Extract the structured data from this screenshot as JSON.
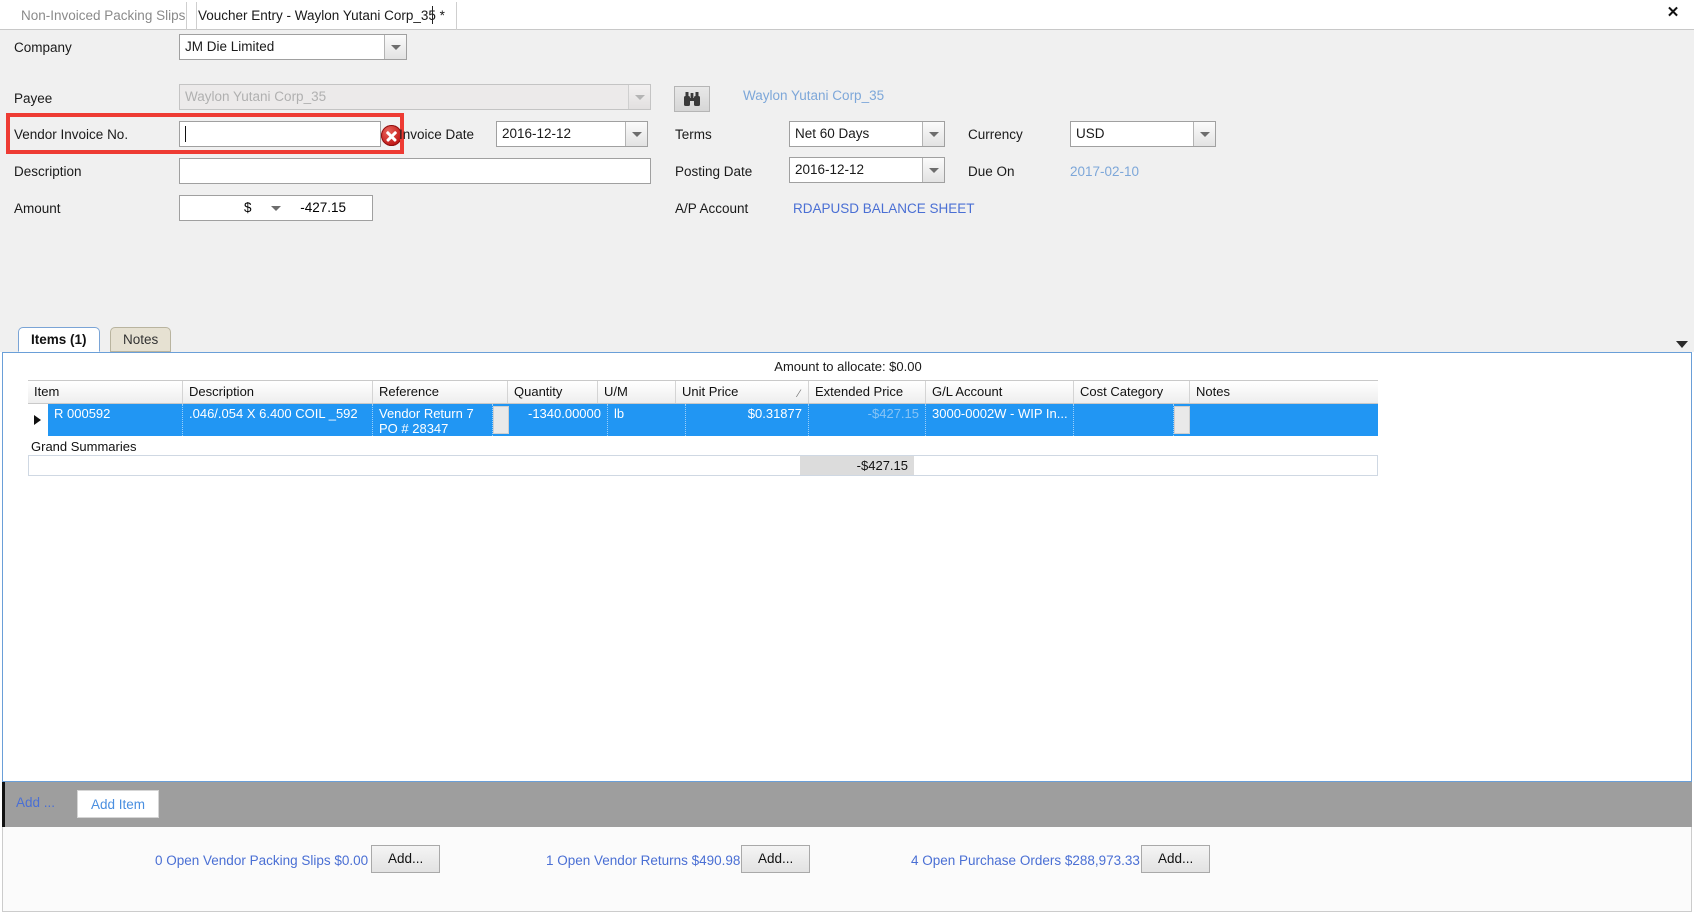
{
  "window": {
    "close_label": "✕"
  },
  "tabs": [
    {
      "label": "Non-Invoiced Packing Slips",
      "active": false
    },
    {
      "label": "Voucher Entry - Waylon Yutani Corp_35 *",
      "active": true
    }
  ],
  "form": {
    "company": {
      "label": "Company",
      "value": "JM Die Limited"
    },
    "payee": {
      "label": "Payee",
      "value": "Waylon Yutani Corp_35"
    },
    "payee_display": "Waylon Yutani Corp_35",
    "search_icon": "binoculars-icon",
    "vendor_invoice_no": {
      "label": "Vendor Invoice No.",
      "value": "",
      "placeholder": ""
    },
    "invoice_date": {
      "label": "Invoice Date",
      "value": "2016-12-12"
    },
    "description": {
      "label": "Description",
      "value": ""
    },
    "amount": {
      "label": "Amount",
      "currency_symbol": "$",
      "value": "-427.15"
    },
    "terms": {
      "label": "Terms",
      "value": "Net 60 Days"
    },
    "posting_date": {
      "label": "Posting Date",
      "value": "2016-12-12"
    },
    "ap_account": {
      "label": "A/P Account",
      "value": "RDAPUSD BALANCE SHEET"
    },
    "currency": {
      "label": "Currency",
      "value": "USD"
    },
    "due_on": {
      "label": "Due On",
      "value": "2017-02-10"
    },
    "error_badge": "error-icon"
  },
  "subtabs": [
    {
      "label": "Items (1)",
      "selected": true
    },
    {
      "label": "Notes",
      "selected": false
    }
  ],
  "grid": {
    "allocate_text": "Amount to allocate: $0.00",
    "columns": [
      "Item",
      "Description",
      "Reference",
      "Quantity",
      "U/M",
      "Unit Price",
      "Extended Price",
      "G/L Account",
      "Cost Category",
      "Notes"
    ],
    "unit_price_sort_glyph": "⁄",
    "rows": [
      {
        "item": "R 000592",
        "description": ".046/.054 X 6.400  COIL _592",
        "reference": "Vendor Return 7\nPO # 28347",
        "quantity": "-1340.00000",
        "um": "lb",
        "unit_price": "$0.31877",
        "extended_price": "-$427.15",
        "gl_account": "3000-0002W -  WIP In...",
        "cost_category": "",
        "notes": ""
      }
    ],
    "summary_label": "Grand Summaries",
    "summary_total": "-$427.15"
  },
  "add_bar": {
    "add_link": "Add ...",
    "add_item_button": "Add Item"
  },
  "status_bar": {
    "entries": [
      {
        "text": "0 Open Vendor Packing Slips $0.00",
        "button": "Add..."
      },
      {
        "text": "1 Open Vendor Returns $490.98",
        "button": "Add..."
      },
      {
        "text": "4 Open Purchase Orders $288,973.33",
        "button": "Add..."
      }
    ]
  },
  "colors": {
    "selection_blue": "#2196f3",
    "error_red": "#ee3b33",
    "link_blue": "#4a6fd4"
  }
}
